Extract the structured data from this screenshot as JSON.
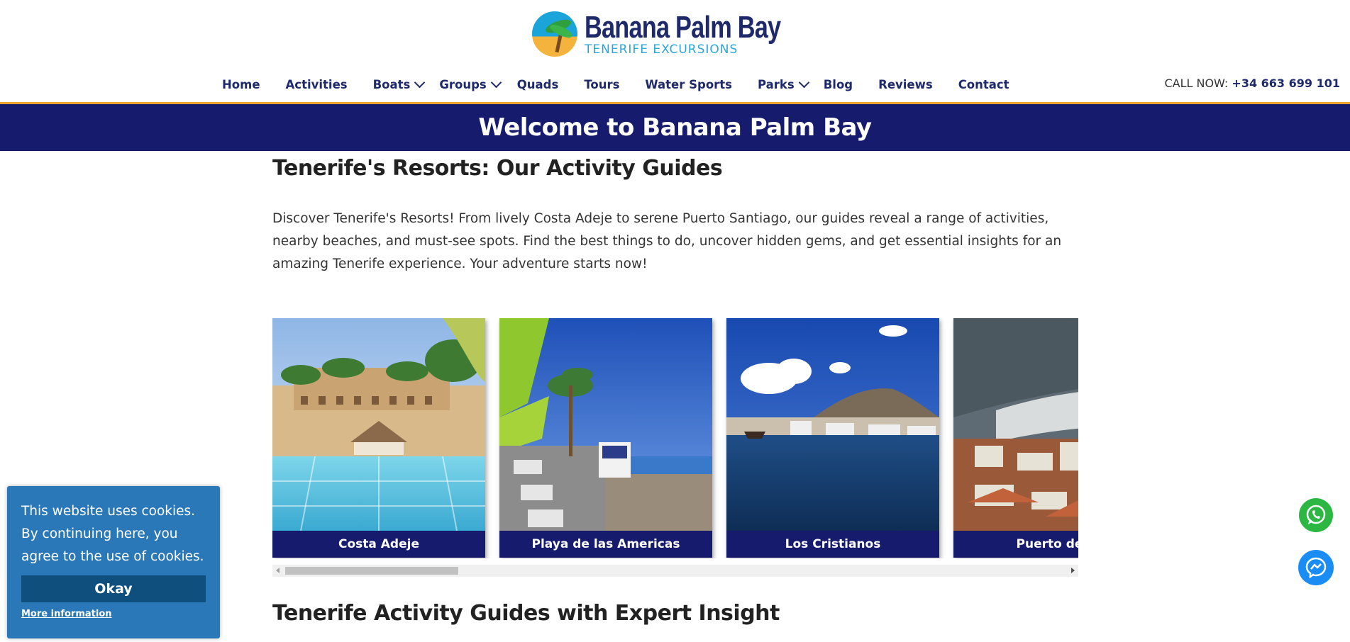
{
  "header": {
    "logo": {
      "name": "Banana Palm Bay",
      "tagline": "TENERIFE EXCURSIONS"
    },
    "nav": [
      {
        "label": "Home",
        "dropdown": false
      },
      {
        "label": "Activities",
        "dropdown": false
      },
      {
        "label": "Boats",
        "dropdown": true
      },
      {
        "label": "Groups",
        "dropdown": true
      },
      {
        "label": "Quads",
        "dropdown": false
      },
      {
        "label": "Tours",
        "dropdown": false
      },
      {
        "label": "Water Sports",
        "dropdown": false
      },
      {
        "label": "Parks",
        "dropdown": true
      },
      {
        "label": "Blog",
        "dropdown": false
      },
      {
        "label": "Reviews",
        "dropdown": false
      },
      {
        "label": "Contact",
        "dropdown": false
      }
    ],
    "call_label": "CALL NOW:",
    "call_number": "+34 663 699 101"
  },
  "banner": {
    "title": "Welcome to Banana Palm Bay"
  },
  "main": {
    "heading": "Tenerife's Resorts: Our Activity Guides",
    "intro": "Discover Tenerife's Resorts! From lively Costa Adeje to serene Puerto Santiago, our guides reveal a range of activities, nearby beaches, and must-see spots. Find the best things to do, uncover hidden gems, and get essential insights for an amazing Tenerife experience. Your adventure starts now!",
    "cards": [
      {
        "caption": "Costa Adeje"
      },
      {
        "caption": "Playa de las Americas"
      },
      {
        "caption": "Los Cristianos"
      },
      {
        "caption": "Puerto del la"
      }
    ],
    "heading2": "Tenerife Activity Guides with Expert Insight"
  },
  "cookie": {
    "message": "This website uses cookies. By continuing here, you agree to the use of cookies.",
    "ok_label": "Okay",
    "more_label": "More information"
  },
  "floating": {
    "whatsapp_icon": "whatsapp-icon",
    "messenger_icon": "messenger-icon"
  },
  "colors": {
    "navy": "#161b6e",
    "accent": "#f0a630",
    "cookie_bg": "#2a78b8",
    "whatsapp": "#2bb741",
    "messenger": "#1a8df5"
  }
}
